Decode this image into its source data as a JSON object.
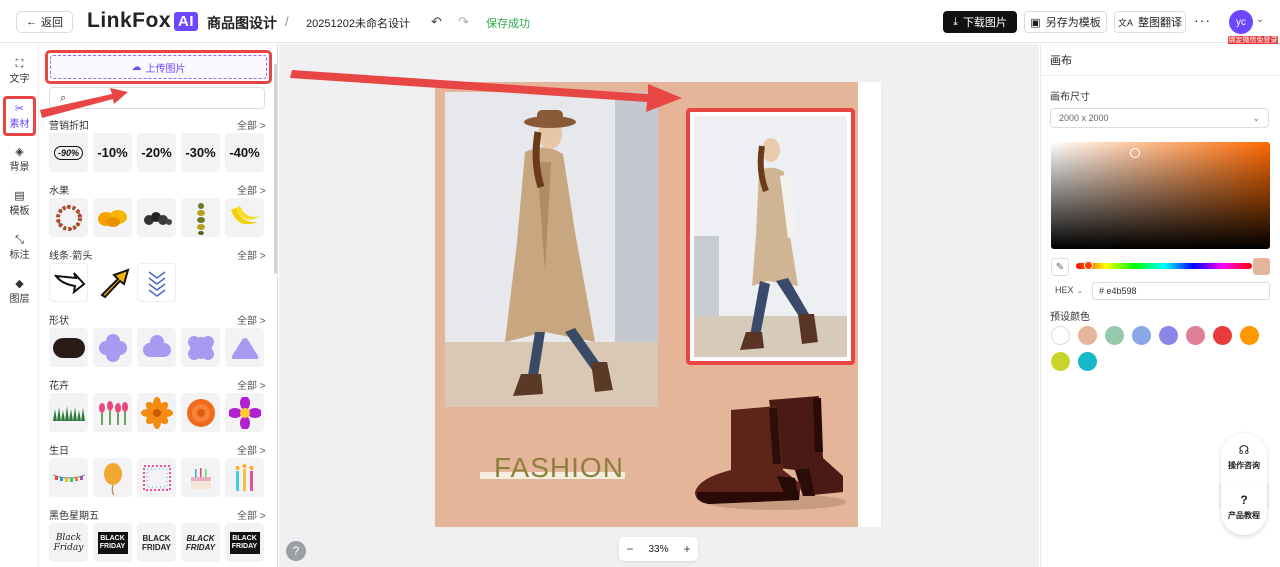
{
  "header": {
    "back_label": "返回",
    "logo_text": "LinkFox",
    "logo_ai": "AI",
    "app_title": "商品图设计",
    "separator": "/",
    "doc_name": "20251202未命名设计",
    "undo_icon": "↶",
    "redo_icon": "↷",
    "save_status": "保存成功",
    "download_label": "下载图片",
    "save_template_label": "另存为模板",
    "translate_label": "整图翻译",
    "more_label": "···",
    "avatar_text": "yc",
    "login_badge": "绑定微信免登录"
  },
  "rail": [
    {
      "label": "文字",
      "icon": "text-icon"
    },
    {
      "label": "素材",
      "icon": "materials-icon",
      "active": true
    },
    {
      "label": "背景",
      "icon": "background-icon"
    },
    {
      "label": "模板",
      "icon": "template-icon"
    },
    {
      "label": "标注",
      "icon": "annotate-icon"
    },
    {
      "label": "图层",
      "icon": "layers-icon"
    }
  ],
  "panel": {
    "upload_label": "上传图片",
    "search_placeholder": "",
    "all_label": "全部 >",
    "sections": [
      {
        "title": "营销折扣",
        "tiles": [
          "-90%",
          "-10%",
          "-20%",
          "-30%",
          "-40%"
        ]
      },
      {
        "title": "水果"
      },
      {
        "title": "线条·箭头"
      },
      {
        "title": "形状"
      },
      {
        "title": "花卉"
      },
      {
        "title": "生日"
      },
      {
        "title": "黑色星期五",
        "tiles": [
          "Black Friday",
          "BLACK FRIDAY",
          "BLACK FRIDAY",
          "BLACK FRIDAY",
          "BLACK FRIDAY"
        ]
      }
    ]
  },
  "canvas": {
    "background_color": "#e4b598",
    "fashion_text": "FASHION",
    "zoom_level": "33%",
    "zoom_out": "−",
    "zoom_in": "+",
    "help": "?"
  },
  "right_panel": {
    "title": "画布",
    "size_label": "画布尺寸",
    "size_value": "2000 x 2000",
    "hex_mode": "HEX",
    "hex_value": "# e4b598",
    "preset_label": "预设颜色",
    "presets": [
      "#ffffff",
      "#e4b598",
      "#96c8aa",
      "#8aa8e8",
      "#8c84e6",
      "#e07e96",
      "#e83c3c",
      "#ff9800",
      "#c8d42a",
      "#17b8c8"
    ]
  },
  "float": {
    "service_label": "操作咨询",
    "guide_label": "产品教程"
  },
  "colors": {
    "accent": "#6c47ff",
    "highlight": "#e84545",
    "success": "#2eab4a"
  }
}
